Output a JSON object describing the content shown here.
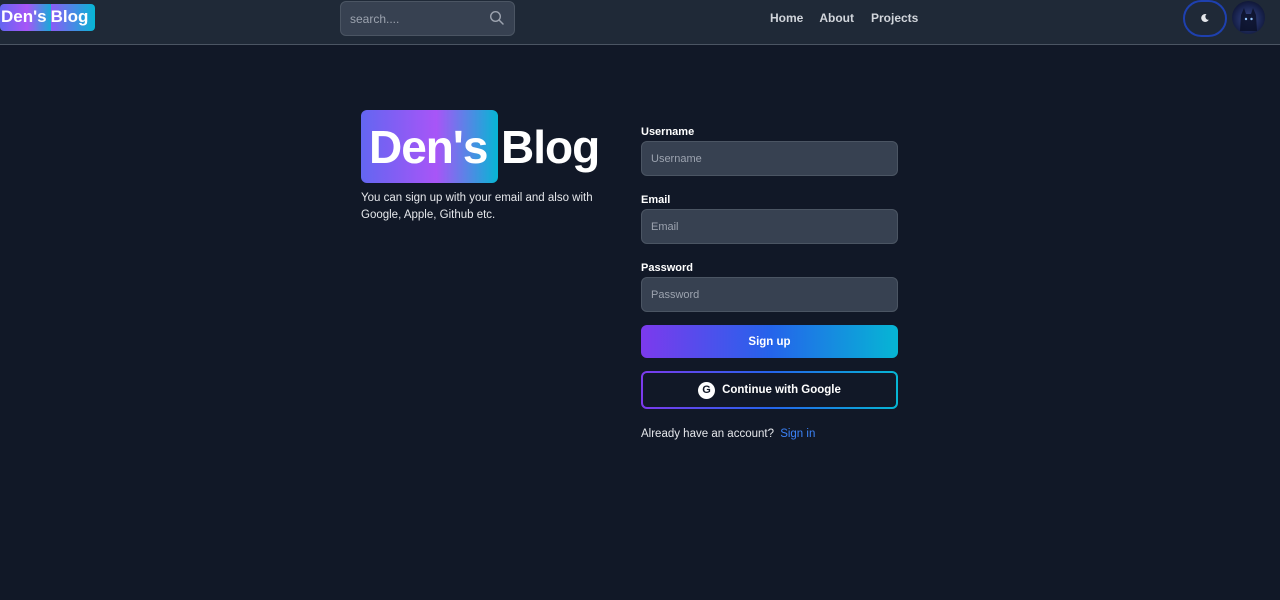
{
  "header": {
    "logo_highlight": "Den's",
    "logo_word": "Blog",
    "search": {
      "placeholder": "search...."
    },
    "nav": {
      "home": "Home",
      "about": "About",
      "projects": "Projects"
    },
    "theme_icon": "moon-icon"
  },
  "intro": {
    "brand_highlight": "Den's",
    "brand_word": "Blog",
    "description": "You can sign up with your email and also with Google, Apple, Github etc."
  },
  "form": {
    "username_label": "Username",
    "username_placeholder": "Username",
    "email_label": "Email",
    "email_placeholder": "Email",
    "password_label": "Password",
    "password_placeholder": "Password",
    "signup_label": "Sign up",
    "google_label": "Continue with Google",
    "google_icon_letter": "G",
    "already_text": "Already have an account?",
    "signin_link": "Sign in"
  },
  "colors": {
    "background": "#111827",
    "navbar": "#1f2937",
    "input": "#374151",
    "gradient_start": "#7c3aed",
    "gradient_end": "#06b6d4",
    "link": "#3b82f6"
  }
}
